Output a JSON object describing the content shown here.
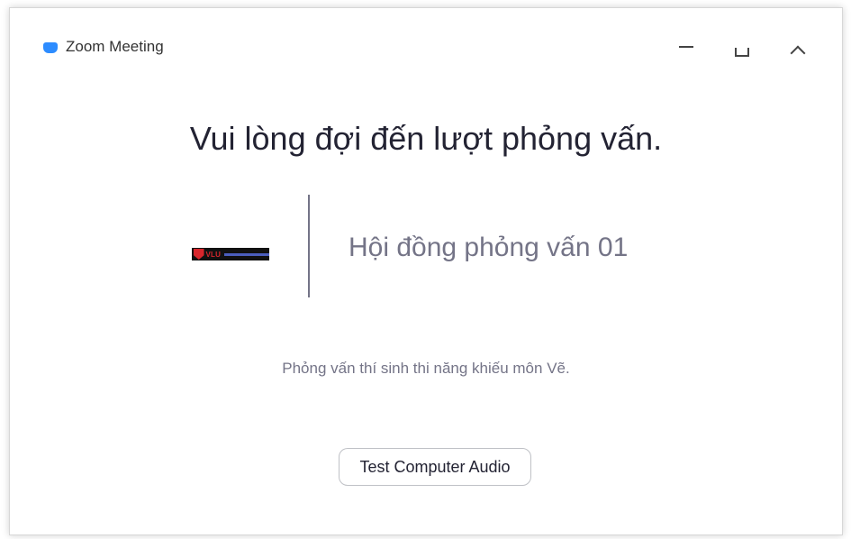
{
  "window": {
    "title": "Zoom Meeting",
    "icon": "zoom-camera-icon",
    "controls": {
      "minimize_icon": "minimize-icon",
      "maximize_icon": "maximize-icon",
      "collapse_icon": "chevron-up-icon"
    }
  },
  "waiting_room": {
    "heading": "Vui lòng đợi đến lượt phỏng vấn.",
    "host_logo": {
      "mark": "VLU",
      "icon": "university-logo"
    },
    "host_name": "Hội đồng phỏng vấn 01",
    "description": "Phỏng vấn thí sinh thi năng khiếu môn Vẽ.",
    "test_audio_label": "Test Computer Audio"
  },
  "colors": {
    "accent": "#2d8cff",
    "heading_text": "#232333",
    "muted_text": "#747487",
    "logo_red": "#d7262c"
  }
}
